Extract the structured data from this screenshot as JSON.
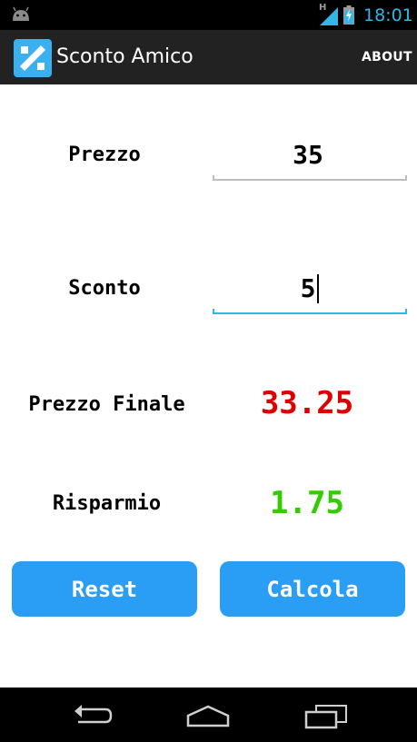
{
  "status_bar": {
    "network_type": "H",
    "time": "18:01",
    "icons": [
      "android-icon",
      "signal-icon",
      "battery-charging-icon"
    ],
    "time_color": "#33b5e5"
  },
  "action_bar": {
    "title": "Sconto Amico",
    "about_label": "ABOUT",
    "icon": "percent-icon",
    "icon_color": "#3ab0f0"
  },
  "form": {
    "price_label": "Prezzo",
    "price_value": "35",
    "discount_label": "Sconto",
    "discount_value": "5",
    "final_price_label": "Prezzo Finale",
    "final_price_value": "33.25",
    "final_price_color": "#dd0000",
    "savings_label": "Risparmio",
    "savings_value": "1.75",
    "savings_color": "#33cc00",
    "focused_field": "discount"
  },
  "buttons": {
    "reset_label": "Reset",
    "calculate_label": "Calcola",
    "color": "#2a9df4"
  },
  "nav_bar": {
    "icons": [
      "back-icon",
      "home-icon",
      "recent-apps-icon"
    ]
  }
}
